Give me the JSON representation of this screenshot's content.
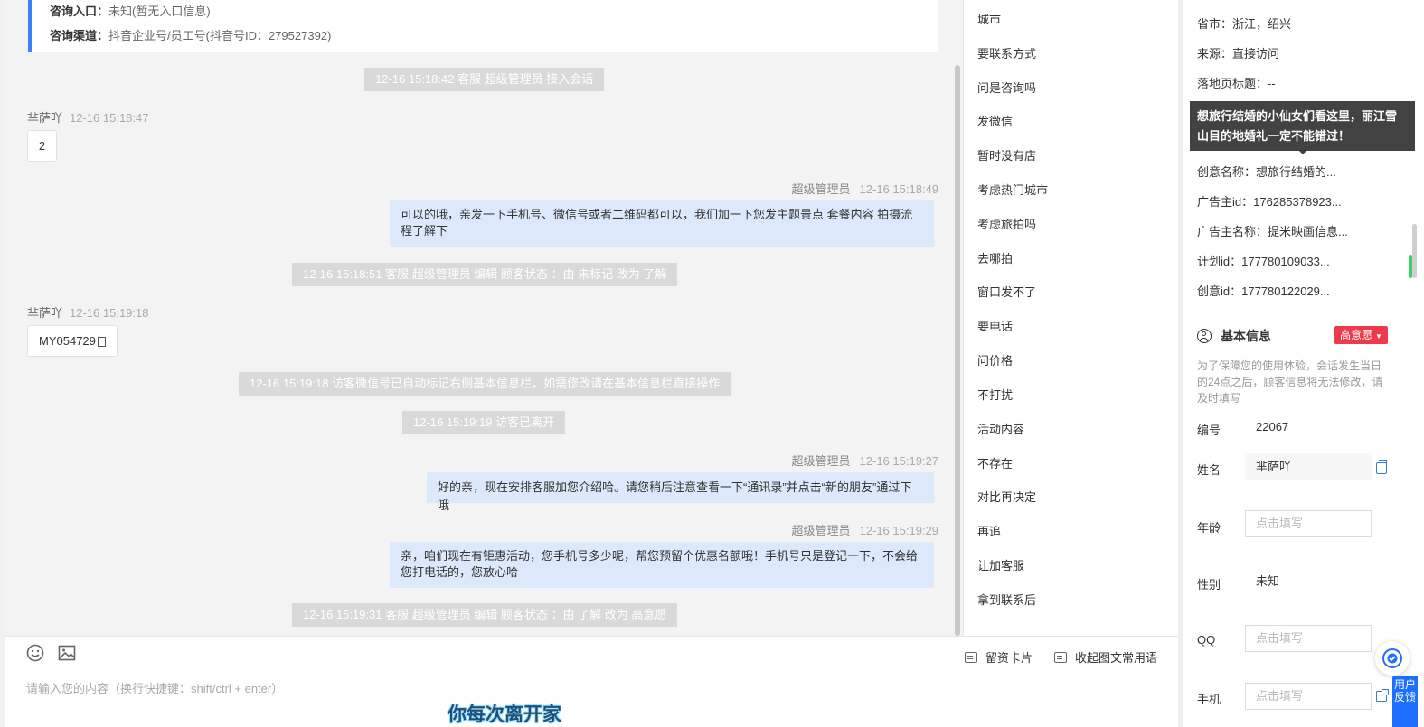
{
  "info_card": {
    "entry_label": "咨询入口：",
    "entry_value": "未知(暂无入口信息)",
    "channel_label": "咨询渠道：",
    "channel_value": "抖音企业号/员工号(抖音号ID：279527392)"
  },
  "chat": {
    "sys1": "12-16 15:18:42 客服 超级管理员 接入会话",
    "visitor_name": "芈萨吖",
    "t1": "12-16 15:18:47",
    "msg1": "2",
    "agent_name": "超级管理员",
    "t2": "12-16 15:18:49",
    "msg2": "可以的哦，亲发一下手机号、微信号或者二维码都可以，我们加一下您发主题景点 套餐内容 拍摄流程了解下",
    "sys2": "12-16 15:18:51 客服 超级管理员 编辑 顾客状态 ：由 未标记 改为 了解",
    "t3": "12-16 15:19:18",
    "msg3": "MY054729",
    "sys3": "12-16 15:19:18 访客微信号已自动标记右侧基本信息栏，如需修改请在基本信息栏直接操作",
    "sys4": "12-16 15:19:19 访客已离开",
    "t4": "12-16 15:19:27",
    "msg4": "好的亲，现在安排客服加您介绍哈。请您稍后注意查看一下“通讯录”并点击“新的朋友”通过下哦",
    "t5": "12-16 15:19:29",
    "msg5": "亲，咱们现在有钜惠活动，您手机号多少呢，帮您预留个优惠名额哦！手机号只是登记一下，不会给您打电话的，您放心哈",
    "sys5": "12-16 15:19:31 客服 超级管理员 编辑 顾客状态 ：由 了解 改为 高意愿"
  },
  "composer": {
    "emoji_icon": "emoji-icon",
    "image_icon": "image-icon",
    "lead_card": "留资卡片",
    "collapse_phrases": "收起图文常用语",
    "placeholder": "请输入您的内容（换行快捷键：shift/ctrl + enter）",
    "overlay_text": "你每次离开家"
  },
  "phrases": [
    "城市",
    "要联系方式",
    "问是咨询吗",
    "发微信",
    "暂时没有店",
    "考虑热门城市",
    "考虑旅拍吗",
    "去哪拍",
    "窗口发不了",
    "要电话",
    "问价格",
    "不打扰",
    "活动内容",
    "不存在",
    "对比再决定",
    "再追",
    "让加客服",
    "拿到联系后"
  ],
  "panel": {
    "province": "省市：浙江，绍兴",
    "source": "来源：直接访问",
    "landing_title": "落地页标题：--",
    "tooltip": "想旅行结婚的小仙女们看这里，丽江雪山目的地婚礼一定不能错过！",
    "creative_name": "创意名称：想旅行结婚的...",
    "advertiser_id": "广告主id：176285378923...",
    "advertiser_name": "广告主名称：提米映画信息...",
    "plan_id": "计划id：177780109033...",
    "creative_id": "创意id：177780122029...",
    "basic_title": "基本信息",
    "intent": "高意愿",
    "hint": "为了保障您的使用体验，会话发生当日的24点之后，顾客信息将无法修改，请及时填写",
    "id_label": "编号",
    "id_value": "22067",
    "name_label": "姓名",
    "name_value": "芈萨吖",
    "age_label": "年龄",
    "age_placeholder": "点击填写",
    "gender_label": "性别",
    "gender_value": "未知",
    "qq_label": "QQ",
    "qq_placeholder": "点击填写",
    "phone_label": "手机",
    "phone_placeholder": "点击填写",
    "feedback": "用户反馈"
  },
  "colors": {
    "accent": "#3b82f6",
    "bubble": "#dce8fb",
    "badge": "#ec3b4c",
    "feedback": "#1e6fff"
  }
}
